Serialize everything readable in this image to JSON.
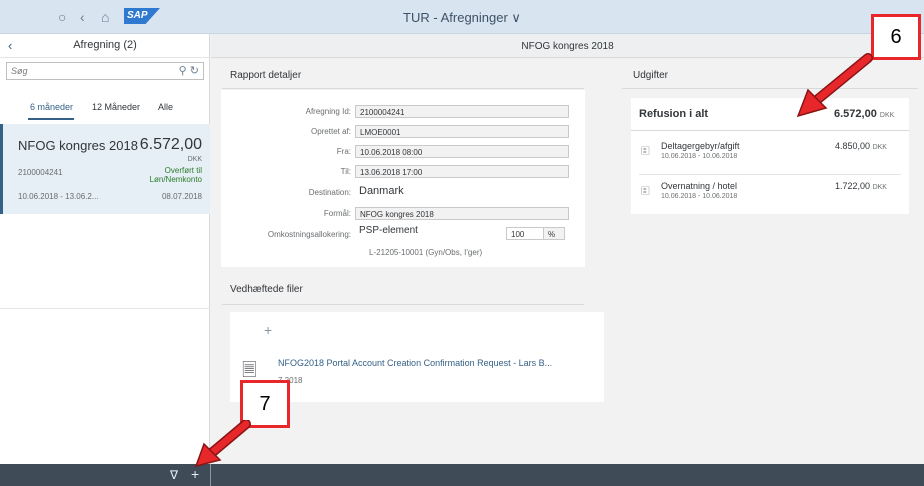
{
  "shell": {
    "title": "TUR - Afregninger ∨",
    "logo": "SAP"
  },
  "master": {
    "title": "Afregning (2)",
    "search_placeholder": "Søg",
    "tabs": [
      "6 måneder",
      "12 Måneder",
      "Alle"
    ],
    "item": {
      "name": "NFOG kongres 2018",
      "amount": "6.572,00",
      "currency": "DKK",
      "id": "2100004241",
      "status_line1": "Overført til",
      "status_line2": "Løn/Nemkonto",
      "dates": "10.06.2018 - 13.06.2...",
      "date2": "08.07.2018"
    }
  },
  "detail": {
    "header": "NFOG kongres 2018",
    "rapport_title": "Rapport detaljer",
    "fields": [
      {
        "label": "Afregning Id:",
        "value": "2100004241"
      },
      {
        "label": "Oprettet af:",
        "value": "LMOE0001"
      },
      {
        "label": "Fra:",
        "value": "10.06.2018 08:00"
      },
      {
        "label": "Til:",
        "value": "13.06.2018 17:00"
      },
      {
        "label": "Destination:",
        "value": "Danmark"
      },
      {
        "label": "Formål:",
        "value": "NFOG kongres 2018"
      },
      {
        "label": "Omkostningsallokering:",
        "value": "PSP-element"
      }
    ],
    "alloc_pct": "100",
    "alloc_unit": "%",
    "alloc_detail": "L-21205-10001 (Gyn/Obs, I'ger)",
    "files_title": "Vedhæftede filer",
    "file_name": "NFOG2018 Portal Account Creation Confirmation Request - Lars B...",
    "file_date": "7 2018",
    "udgifter_title": "Udgifter",
    "refusion_label": "Refusion i alt",
    "refusion_amount": "6.572,00",
    "refusion_cur": "DKK",
    "expenses": [
      {
        "name": "Deltagergebyr/afgift",
        "dates": "10.06.2018 - 10.06.2018",
        "amount": "4.850,00",
        "cur": "DKK"
      },
      {
        "name": "Overnatning / hotel",
        "dates": "10.06.2018 - 10.06.2018",
        "amount": "1.722,00",
        "cur": "DKK"
      }
    ]
  },
  "callouts": {
    "c6": "6",
    "c7": "7"
  },
  "colors": {
    "accent": "#346187",
    "callout_border": "#e8272b",
    "arrow": "#e8272b"
  }
}
